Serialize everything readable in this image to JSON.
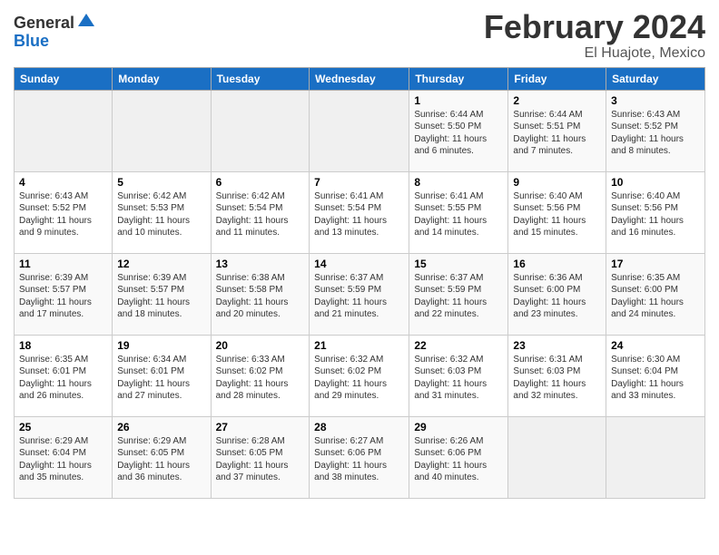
{
  "header": {
    "logo_general": "General",
    "logo_blue": "Blue",
    "month_title": "February 2024",
    "location": "El Huajote, Mexico"
  },
  "days_of_week": [
    "Sunday",
    "Monday",
    "Tuesday",
    "Wednesday",
    "Thursday",
    "Friday",
    "Saturday"
  ],
  "weeks": [
    [
      {
        "day": "",
        "info": ""
      },
      {
        "day": "",
        "info": ""
      },
      {
        "day": "",
        "info": ""
      },
      {
        "day": "",
        "info": ""
      },
      {
        "day": "1",
        "info": "Sunrise: 6:44 AM\nSunset: 5:50 PM\nDaylight: 11 hours\nand 6 minutes."
      },
      {
        "day": "2",
        "info": "Sunrise: 6:44 AM\nSunset: 5:51 PM\nDaylight: 11 hours\nand 7 minutes."
      },
      {
        "day": "3",
        "info": "Sunrise: 6:43 AM\nSunset: 5:52 PM\nDaylight: 11 hours\nand 8 minutes."
      }
    ],
    [
      {
        "day": "4",
        "info": "Sunrise: 6:43 AM\nSunset: 5:52 PM\nDaylight: 11 hours\nand 9 minutes."
      },
      {
        "day": "5",
        "info": "Sunrise: 6:42 AM\nSunset: 5:53 PM\nDaylight: 11 hours\nand 10 minutes."
      },
      {
        "day": "6",
        "info": "Sunrise: 6:42 AM\nSunset: 5:54 PM\nDaylight: 11 hours\nand 11 minutes."
      },
      {
        "day": "7",
        "info": "Sunrise: 6:41 AM\nSunset: 5:54 PM\nDaylight: 11 hours\nand 13 minutes."
      },
      {
        "day": "8",
        "info": "Sunrise: 6:41 AM\nSunset: 5:55 PM\nDaylight: 11 hours\nand 14 minutes."
      },
      {
        "day": "9",
        "info": "Sunrise: 6:40 AM\nSunset: 5:56 PM\nDaylight: 11 hours\nand 15 minutes."
      },
      {
        "day": "10",
        "info": "Sunrise: 6:40 AM\nSunset: 5:56 PM\nDaylight: 11 hours\nand 16 minutes."
      }
    ],
    [
      {
        "day": "11",
        "info": "Sunrise: 6:39 AM\nSunset: 5:57 PM\nDaylight: 11 hours\nand 17 minutes."
      },
      {
        "day": "12",
        "info": "Sunrise: 6:39 AM\nSunset: 5:57 PM\nDaylight: 11 hours\nand 18 minutes."
      },
      {
        "day": "13",
        "info": "Sunrise: 6:38 AM\nSunset: 5:58 PM\nDaylight: 11 hours\nand 20 minutes."
      },
      {
        "day": "14",
        "info": "Sunrise: 6:37 AM\nSunset: 5:59 PM\nDaylight: 11 hours\nand 21 minutes."
      },
      {
        "day": "15",
        "info": "Sunrise: 6:37 AM\nSunset: 5:59 PM\nDaylight: 11 hours\nand 22 minutes."
      },
      {
        "day": "16",
        "info": "Sunrise: 6:36 AM\nSunset: 6:00 PM\nDaylight: 11 hours\nand 23 minutes."
      },
      {
        "day": "17",
        "info": "Sunrise: 6:35 AM\nSunset: 6:00 PM\nDaylight: 11 hours\nand 24 minutes."
      }
    ],
    [
      {
        "day": "18",
        "info": "Sunrise: 6:35 AM\nSunset: 6:01 PM\nDaylight: 11 hours\nand 26 minutes."
      },
      {
        "day": "19",
        "info": "Sunrise: 6:34 AM\nSunset: 6:01 PM\nDaylight: 11 hours\nand 27 minutes."
      },
      {
        "day": "20",
        "info": "Sunrise: 6:33 AM\nSunset: 6:02 PM\nDaylight: 11 hours\nand 28 minutes."
      },
      {
        "day": "21",
        "info": "Sunrise: 6:32 AM\nSunset: 6:02 PM\nDaylight: 11 hours\nand 29 minutes."
      },
      {
        "day": "22",
        "info": "Sunrise: 6:32 AM\nSunset: 6:03 PM\nDaylight: 11 hours\nand 31 minutes."
      },
      {
        "day": "23",
        "info": "Sunrise: 6:31 AM\nSunset: 6:03 PM\nDaylight: 11 hours\nand 32 minutes."
      },
      {
        "day": "24",
        "info": "Sunrise: 6:30 AM\nSunset: 6:04 PM\nDaylight: 11 hours\nand 33 minutes."
      }
    ],
    [
      {
        "day": "25",
        "info": "Sunrise: 6:29 AM\nSunset: 6:04 PM\nDaylight: 11 hours\nand 35 minutes."
      },
      {
        "day": "26",
        "info": "Sunrise: 6:29 AM\nSunset: 6:05 PM\nDaylight: 11 hours\nand 36 minutes."
      },
      {
        "day": "27",
        "info": "Sunrise: 6:28 AM\nSunset: 6:05 PM\nDaylight: 11 hours\nand 37 minutes."
      },
      {
        "day": "28",
        "info": "Sunrise: 6:27 AM\nSunset: 6:06 PM\nDaylight: 11 hours\nand 38 minutes."
      },
      {
        "day": "29",
        "info": "Sunrise: 6:26 AM\nSunset: 6:06 PM\nDaylight: 11 hours\nand 40 minutes."
      },
      {
        "day": "",
        "info": ""
      },
      {
        "day": "",
        "info": ""
      }
    ]
  ]
}
